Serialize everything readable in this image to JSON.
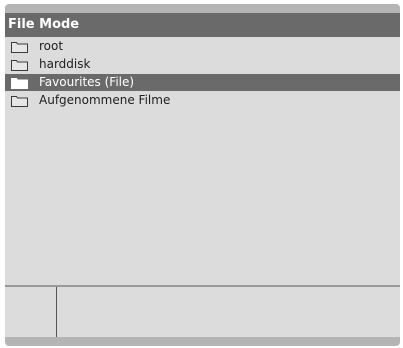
{
  "window": {
    "title": "File Mode"
  },
  "file_list": {
    "items": [
      {
        "label": "root",
        "icon": "folder-icon",
        "selected": false
      },
      {
        "label": "harddisk",
        "icon": "folder-icon",
        "selected": false
      },
      {
        "label": "Favourites (File)",
        "icon": "folder-icon",
        "selected": true
      },
      {
        "label": "Aufgenommene Filme",
        "icon": "folder-icon",
        "selected": false
      }
    ]
  },
  "colors": {
    "title_bar": "#6a6a6a",
    "panel_background": "#dcdcdc",
    "selection": "#6a6a6a",
    "border_bar": "#b4b4b4"
  }
}
